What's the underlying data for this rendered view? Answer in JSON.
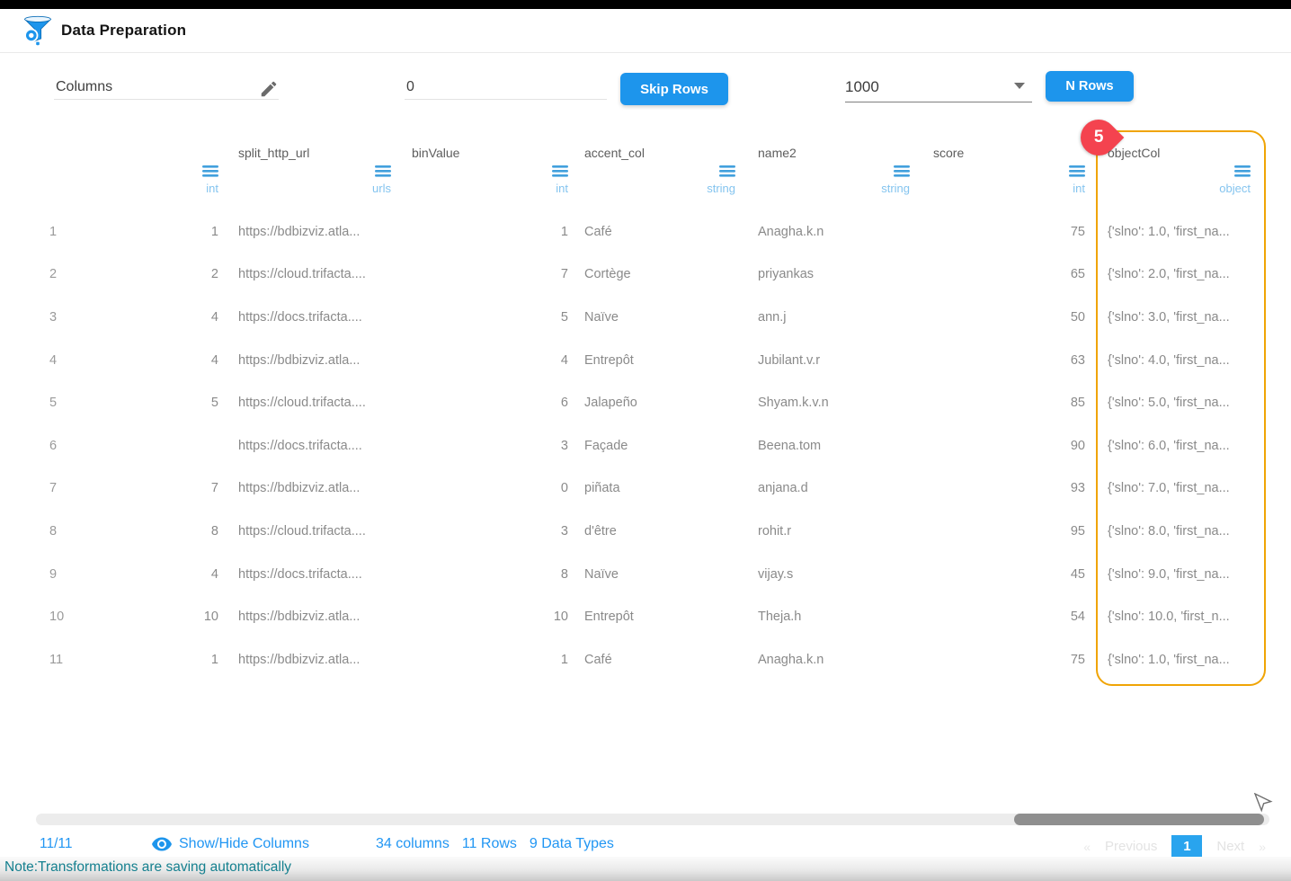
{
  "app": {
    "title": "Data Preparation"
  },
  "toolbar": {
    "columns_field": {
      "value": "Columns"
    },
    "skip_field": {
      "value": "0"
    },
    "skip_button": "Skip Rows",
    "rows_select": {
      "value": "1000"
    },
    "rows_button": "N Rows"
  },
  "table": {
    "columns": [
      {
        "name": "",
        "type": "int"
      },
      {
        "name": "split_http_url",
        "type": "urls"
      },
      {
        "name": "binValue",
        "type": "int"
      },
      {
        "name": "accent_col",
        "type": "string"
      },
      {
        "name": "name2",
        "type": "string"
      },
      {
        "name": "score",
        "type": "int"
      },
      {
        "name": "objectCol",
        "type": "object"
      }
    ],
    "highlight": {
      "column": "objectCol",
      "badge": "5"
    },
    "rows": [
      {
        "index": "1",
        "cells": [
          "1",
          "https://bdbizviz.atla...",
          "1",
          "Café",
          "Anagha.k.n",
          "75",
          "{'slno': 1.0, 'first_na..."
        ]
      },
      {
        "index": "2",
        "cells": [
          "2",
          "https://cloud.trifacta....",
          "7",
          "Cortège",
          "priyankas",
          "65",
          "{'slno': 2.0, 'first_na..."
        ]
      },
      {
        "index": "3",
        "cells": [
          "4",
          "https://docs.trifacta....",
          "5",
          "Naïve",
          "ann.j",
          "50",
          "{'slno': 3.0, 'first_na..."
        ]
      },
      {
        "index": "4",
        "cells": [
          "4",
          "https://bdbizviz.atla...",
          "4",
          "Entrepôt",
          "Jubilant.v.r",
          "63",
          "{'slno': 4.0, 'first_na..."
        ]
      },
      {
        "index": "5",
        "cells": [
          "5",
          "https://cloud.trifacta....",
          "6",
          "Jalapeño",
          "Shyam.k.v.n",
          "85",
          "{'slno': 5.0, 'first_na..."
        ]
      },
      {
        "index": "6",
        "cells": [
          "",
          "https://docs.trifacta....",
          "3",
          "Façade",
          "Beena.tom",
          "90",
          "{'slno': 6.0, 'first_na..."
        ]
      },
      {
        "index": "7",
        "cells": [
          "7",
          "https://bdbizviz.atla...",
          "0",
          "piñata",
          "anjana.d",
          "93",
          "{'slno': 7.0, 'first_na..."
        ]
      },
      {
        "index": "8",
        "cells": [
          "8",
          "https://cloud.trifacta....",
          "3",
          "d'être",
          "rohit.r",
          "95",
          "{'slno': 8.0, 'first_na..."
        ]
      },
      {
        "index": "9",
        "cells": [
          "4",
          "https://docs.trifacta....",
          "8",
          "Naïve",
          "vijay.s",
          "45",
          "{'slno': 9.0, 'first_na..."
        ]
      },
      {
        "index": "10",
        "cells": [
          "10",
          "https://bdbizviz.atla...",
          "10",
          "Entrepôt",
          "Theja.h",
          "54",
          "{'slno': 10.0, 'first_n..."
        ]
      },
      {
        "index": "11",
        "cells": [
          "1",
          "https://bdbizviz.atla...",
          "1",
          "Café",
          "Anagha.k.n",
          "75",
          "{'slno': 1.0, 'first_na..."
        ]
      }
    ]
  },
  "footer": {
    "visible_fraction": "11/11",
    "show_hide_label": "Show/Hide Columns",
    "stats": {
      "columns": "34 columns",
      "rows": "11 Rows",
      "types": "9 Data Types"
    },
    "pagination": {
      "prev_symbol": "«",
      "prev_label": "Previous",
      "current_page": "1",
      "next_label": "Next",
      "next_symbol": "»"
    },
    "note": "Note:Transformations are saving automatically"
  },
  "colors": {
    "accent_blue": "#1d95ec",
    "link_blue": "#2196f3",
    "menu_icon_blue": "#42a0dd",
    "type_label_blue": "#84c4ef",
    "highlight_orange": "#f0a405",
    "badge_red": "#f4434f",
    "note_teal": "#15808f"
  }
}
